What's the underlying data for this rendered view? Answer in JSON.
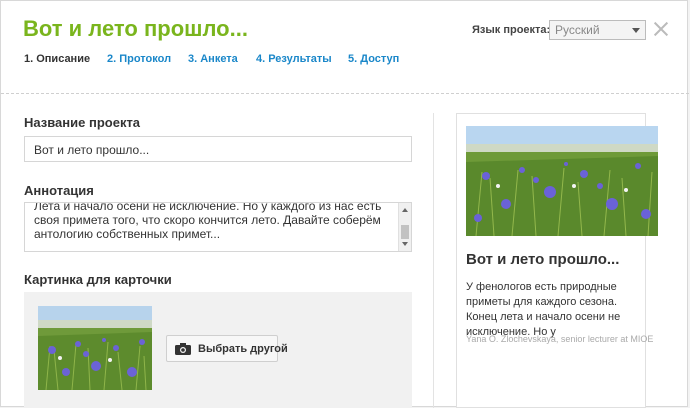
{
  "header": {
    "title": "Вот и лето прошло...",
    "language_label": "Язык проекта:",
    "language_value": "Русский",
    "close_icon": "close-icon"
  },
  "tabs": [
    {
      "label": "1. Описание",
      "active": true
    },
    {
      "label": "2. Протокол",
      "active": false
    },
    {
      "label": "3. Анкета",
      "active": false
    },
    {
      "label": "4. Результаты",
      "active": false
    },
    {
      "label": "5. Доступ",
      "active": false
    }
  ],
  "form": {
    "name_label": "Название проекта",
    "name_value": "Вот и лето прошло...",
    "annotation_label": "Аннотация",
    "annotation_value": "Лета и начало осени не исключение. Но у каждого из нас есть своя примета того, что скоро кончится лето. Давайте соберём антологию собственных примет...",
    "picture_label": "Картинка для карточки",
    "choose_button": "Выбрать другой"
  },
  "card": {
    "title": "Вот и лето прошло...",
    "text": "У фенологов есть природные приметы для каждого сезона. Конец лета и начало осени не исключение. Но у",
    "author": "Yana O. Zlochevskaya, senior lecturer at MIOE"
  },
  "colors": {
    "accent_green": "#7ab51d",
    "link_blue": "#1a87c9"
  }
}
